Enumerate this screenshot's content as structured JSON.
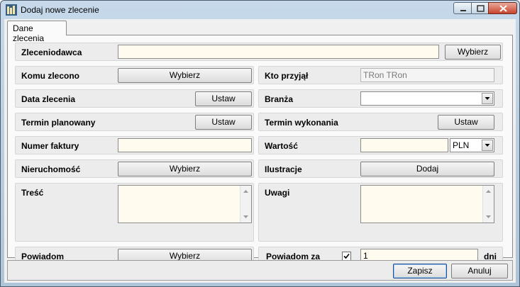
{
  "window": {
    "title": "Dodaj nowe zlecenie"
  },
  "tabs": [
    {
      "label": "Dane zlecenia"
    }
  ],
  "form": {
    "zleceniodawca": {
      "label": "Zleceniodawca",
      "value": "",
      "button": "Wybierz"
    },
    "komu_zlecono": {
      "label": "Komu zlecono",
      "button": "Wybierz"
    },
    "kto_przyjal": {
      "label": "Kto przyjął",
      "value": "TRon TRon"
    },
    "data_zlecenia": {
      "label": "Data zlecenia",
      "button": "Ustaw"
    },
    "branza": {
      "label": "Branża",
      "value": ""
    },
    "termin_planowany": {
      "label": "Termin planowany",
      "button": "Ustaw"
    },
    "termin_wykonania": {
      "label": "Termin wykonania",
      "button": "Ustaw"
    },
    "numer_faktury": {
      "label": "Numer faktury",
      "value": ""
    },
    "wartosc": {
      "label": "Wartość",
      "value": "",
      "currency": "PLN"
    },
    "nieruchomosc": {
      "label": "Nieruchomość",
      "button": "Wybierz"
    },
    "ilustracje": {
      "label": "Ilustracje",
      "button": "Dodaj"
    },
    "tresc": {
      "label": "Treść",
      "value": ""
    },
    "uwagi": {
      "label": "Uwagi",
      "value": ""
    },
    "powiadom": {
      "label": "Powiadom",
      "button": "Wybierz"
    },
    "powiadom_za": {
      "label": "Powiadom za",
      "checked": true,
      "value": "1",
      "unit": "dni"
    }
  },
  "footer": {
    "save": "Zapisz",
    "cancel": "Anuluj"
  },
  "icons": {
    "app": "app-icon",
    "minimize": "minimize-icon",
    "maximize": "maximize-icon",
    "close": "close-icon"
  }
}
